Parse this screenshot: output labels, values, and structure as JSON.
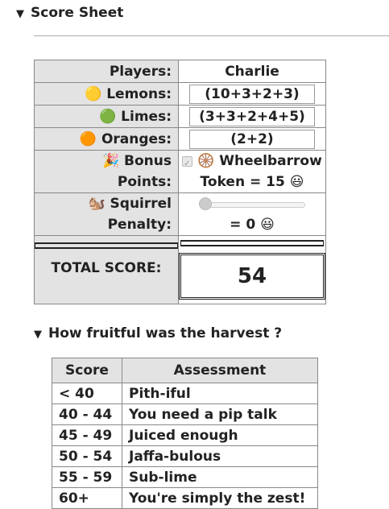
{
  "section": {
    "title": "Score Sheet"
  },
  "players": {
    "label": "Players:",
    "name": "Charlie"
  },
  "lemons": {
    "emoji": "🟡",
    "label": "Lemons:",
    "value": "(10+3+2+3)"
  },
  "limes": {
    "emoji": "🟢",
    "label": "Limes:",
    "value": "(3+3+2+4+5)"
  },
  "oranges": {
    "emoji": "🟠",
    "label": "Oranges:",
    "value": "(2+2)"
  },
  "bonus": {
    "emoji": "🎉",
    "label1": "Bonus",
    "label2": "Points:",
    "checked": true,
    "wheel_emoji": "🛞",
    "text1": "Wheelbarrow",
    "text2": "Token = 15",
    "face": "😃"
  },
  "squirrel": {
    "emoji": "🐿️",
    "label1": "Squirrel",
    "label2": "Penalty:",
    "slider_level": 0,
    "result": "= 0",
    "face": "😃"
  },
  "total": {
    "label": "TOTAL SCORE:",
    "value": "54"
  },
  "harvest": {
    "title": "How fruitful was the harvest ?",
    "headers": [
      "Score",
      "Assessment"
    ],
    "rows": [
      [
        "< 40",
        "Pith-iful"
      ],
      [
        "40 - 44",
        "You need a pip talk"
      ],
      [
        "45 - 49",
        "Juiced enough"
      ],
      [
        "50 - 54",
        "Jaffa-bulous"
      ],
      [
        "55 - 59",
        "Sub-lime"
      ],
      [
        "60+",
        "You're simply the zest!"
      ]
    ]
  }
}
